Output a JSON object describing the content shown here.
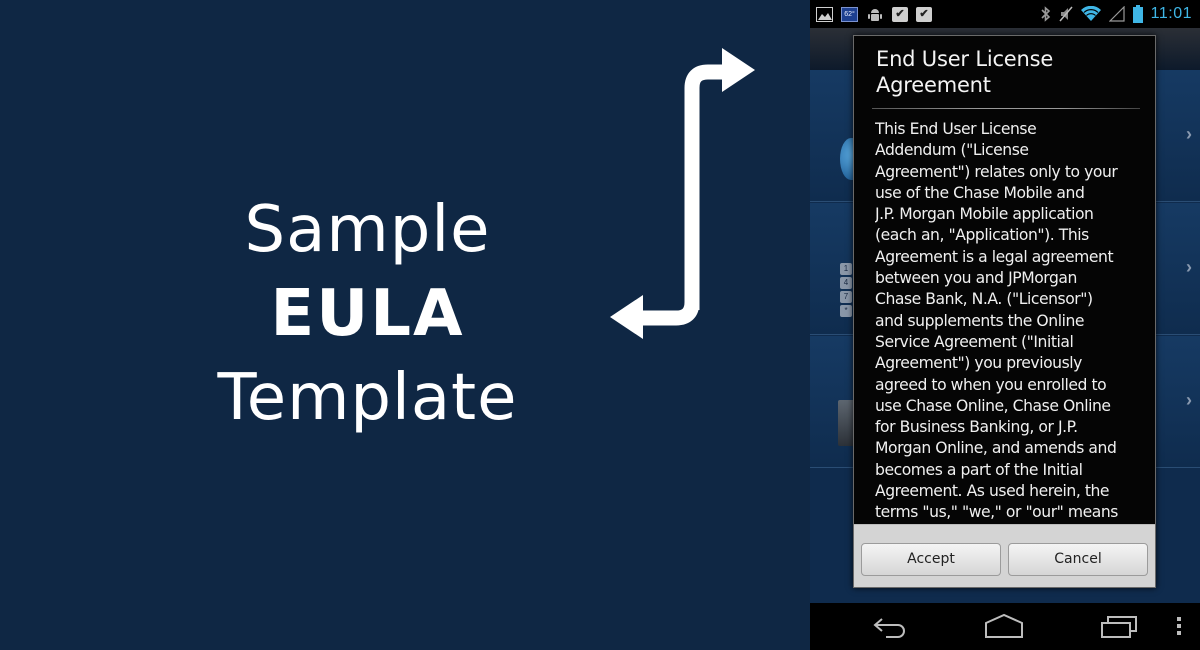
{
  "hero": {
    "line1": "Sample",
    "line2": "EULA",
    "line3": "Template"
  },
  "colors": {
    "background": "#0f2744",
    "dialog_bg": "#050505",
    "button_bar": "#d4d4d4",
    "clock": "#3fb6e6"
  },
  "phone": {
    "statusbar": {
      "left_icons": [
        "gallery-icon",
        "weather-temp-icon",
        "android-debug-icon",
        "store-check-icon",
        "store-check-icon"
      ],
      "temperature": "62°",
      "right_icons": [
        "bluetooth-icon",
        "mute-icon",
        "wifi-icon",
        "signal-icon",
        "battery-icon"
      ],
      "time": "11:01"
    },
    "list_rows": [
      {
        "chevron": "›"
      },
      {
        "chevron": "›"
      },
      {
        "chevron": "›"
      }
    ],
    "keypad_keys": [
      "1",
      "4",
      "7",
      "*"
    ],
    "dialog": {
      "title_line1": "End User License",
      "title_line2": "Agreement",
      "body_lines": [
        "This End User License",
        "Addendum (\"License",
        "Agreement\") relates only to your",
        "use of the Chase Mobile and",
        "J.P. Morgan Mobile application",
        "(each an, \"Application\"). This",
        "Agreement is a legal agreement",
        "between you and JPMorgan",
        "Chase Bank, N.A. (\"Licensor\")",
        "and supplements the Online",
        "Service Agreement (\"Initial",
        "Agreement\") you previously",
        "agreed to when you enrolled to",
        "use Chase Online, Chase Online",
        "for Business Banking, or J.P.",
        "Morgan Online, and amends and",
        "becomes a part of the Initial",
        "Agreement. As used herein, the",
        "terms \"us,\" \"we,\" or \"our\" means"
      ],
      "accept_label": "Accept",
      "cancel_label": "Cancel"
    },
    "navbar": [
      "back-icon",
      "home-icon",
      "recent-apps-icon",
      "overflow-menu-icon"
    ]
  }
}
